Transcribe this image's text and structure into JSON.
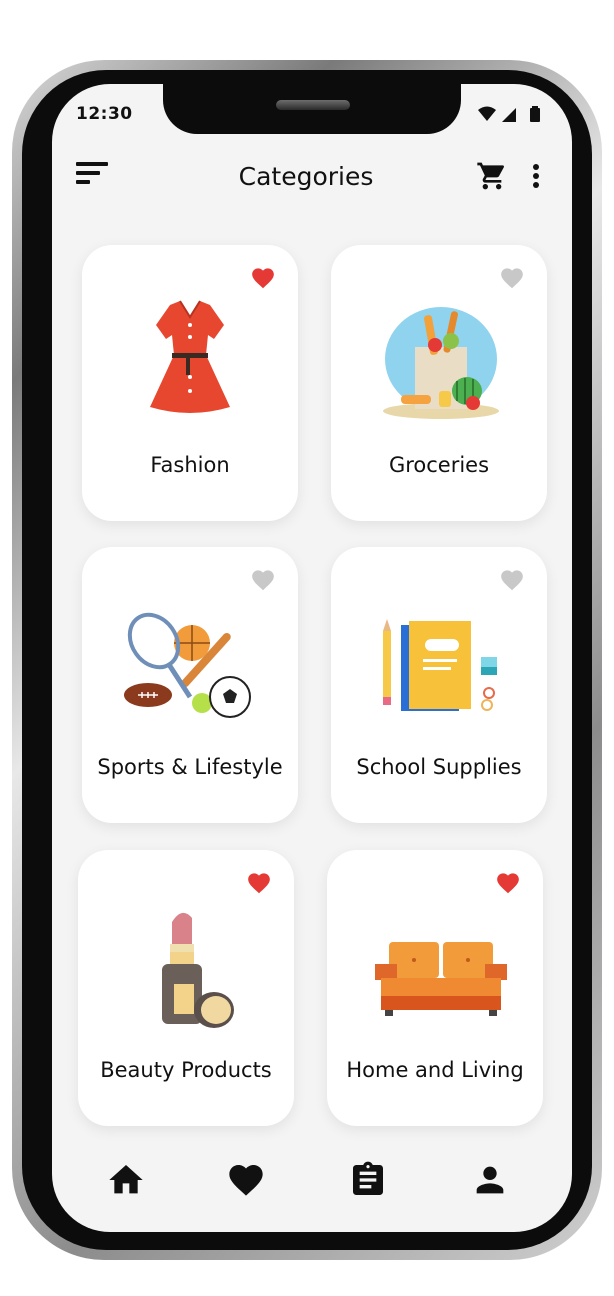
{
  "status": {
    "time": "12:30"
  },
  "header": {
    "title": "Categories",
    "menu_icon": "sort-menu-icon",
    "cart_icon": "cart-icon",
    "more_icon": "more-vert-icon"
  },
  "categories": [
    {
      "label": "Fashion",
      "favorite": true,
      "icon": "dress-illustration"
    },
    {
      "label": "Groceries",
      "favorite": false,
      "icon": "grocery-bag-illustration"
    },
    {
      "label": "Sports & Lifestyle",
      "favorite": false,
      "icon": "sports-balls-illustration"
    },
    {
      "label": "School Supplies",
      "favorite": false,
      "icon": "notebook-pencil-illustration"
    },
    {
      "label": "Beauty Products",
      "favorite": true,
      "icon": "lipstick-illustration"
    },
    {
      "label": "Home and Living",
      "favorite": true,
      "icon": "sofa-illustration"
    }
  ],
  "bottom_nav": [
    {
      "icon": "home-icon"
    },
    {
      "icon": "heart-icon"
    },
    {
      "icon": "clipboard-icon"
    },
    {
      "icon": "person-icon"
    }
  ],
  "colors": {
    "favorite_on": "#e53935",
    "favorite_off": "#c8c8c8",
    "screen_bg": "#f4f4f4",
    "card_bg": "#ffffff"
  }
}
